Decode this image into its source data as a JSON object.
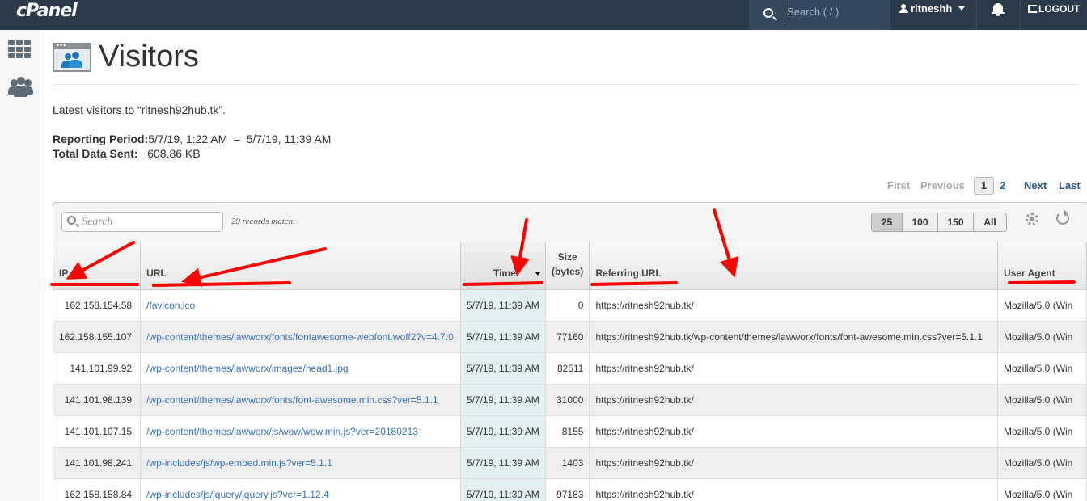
{
  "topbar": {
    "logo": "cPanel",
    "search_placeholder": "Search ( / )",
    "username": "ritneshh",
    "logout": "LOGOUT"
  },
  "page": {
    "title": "Visitors",
    "description": "Latest visitors to “ritnesh92hub.tk”.",
    "period_label": "Reporting Period:",
    "period_value": "5/7/19, 1:22 AM  –  5/7/19, 11:39 AM",
    "total_label": "Total Data Sent:",
    "total_value": "608.86 KB"
  },
  "pagination": {
    "first": "First",
    "previous": "Previous",
    "current": "1",
    "page2": "2",
    "next": "Next",
    "last": "Last"
  },
  "toolbar": {
    "search_placeholder": "Search",
    "records": "29 records match.",
    "page_sizes": [
      "25",
      "100",
      "150",
      "All"
    ],
    "active_page_size": "25"
  },
  "table": {
    "headers": {
      "ip": "IP",
      "url": "URL",
      "time": "Time",
      "size_line1": "Size",
      "size_line2": "(bytes)",
      "referrer": "Referring URL",
      "agent": "User Agent"
    },
    "rows": [
      {
        "ip": "162.158.154.58",
        "url": "/favicon.ico",
        "time": "5/7/19, 11:39 AM",
        "size": "0",
        "referrer": "https://ritnesh92hub.tk/",
        "agent": "Mozilla/5.0 (Win"
      },
      {
        "ip": "162.158.155.107",
        "url": "/wp-content/themes/lawworx/fonts/fontawesome-webfont.woff2?v=4.7.0",
        "time": "5/7/19, 11:39 AM",
        "size": "77160",
        "referrer": "https://ritnesh92hub.tk/wp-content/themes/lawworx/fonts/font-awesome.min.css?ver=5.1.1",
        "agent": "Mozilla/5.0 (Win"
      },
      {
        "ip": "141.101.99.92",
        "url": "/wp-content/themes/lawworx/images/head1.jpg",
        "time": "5/7/19, 11:39 AM",
        "size": "82511",
        "referrer": "https://ritnesh92hub.tk/",
        "agent": "Mozilla/5.0 (Win"
      },
      {
        "ip": "141.101.98.139",
        "url": "/wp-content/themes/lawworx/fonts/font-awesome.min.css?ver=5.1.1",
        "time": "5/7/19, 11:39 AM",
        "size": "31000",
        "referrer": "https://ritnesh92hub.tk/",
        "agent": "Mozilla/5.0 (Win"
      },
      {
        "ip": "141.101.107.15",
        "url": "/wp-content/themes/lawworx/js/wow/wow.min.js?ver=20180213",
        "time": "5/7/19, 11:39 AM",
        "size": "8155",
        "referrer": "https://ritnesh92hub.tk/",
        "agent": "Mozilla/5.0 (Win"
      },
      {
        "ip": "141.101.98.241",
        "url": "/wp-includes/js/wp-embed.min.js?ver=5.1.1",
        "time": "5/7/19, 11:39 AM",
        "size": "1403",
        "referrer": "https://ritnesh92hub.tk/",
        "agent": "Mozilla/5.0 (Win"
      },
      {
        "ip": "162.158.158.84",
        "url": "/wp-includes/js/jquery/jquery.js?ver=1.12.4",
        "time": "5/7/19, 11:39 AM",
        "size": "97183",
        "referrer": "https://ritnesh92hub.tk/",
        "agent": "Mozilla/5.0 (Win"
      }
    ]
  },
  "colors": {
    "topbar": "#293a4a",
    "link": "#3b73b9",
    "annotation": "#ff0000",
    "sorted_column": "#e2f0ef"
  }
}
